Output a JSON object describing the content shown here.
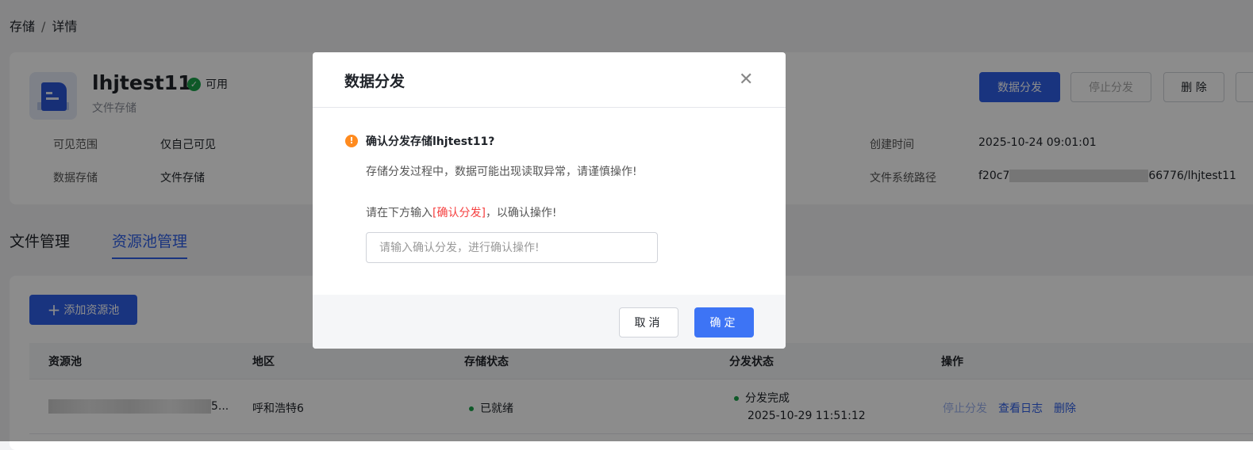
{
  "breadcrumb": {
    "root": "存储",
    "sep": "/",
    "current": "详情"
  },
  "storage": {
    "name": "lhjtest11",
    "status": "可用",
    "type": "文件存储"
  },
  "header_buttons": {
    "distribute": "数据分发",
    "stop": "停止分发",
    "delete": "删 除"
  },
  "info": {
    "visibility_label": "可见范围",
    "visibility": "仅自己可见",
    "storage_label": "数据存储",
    "storage": "文件存储",
    "created_label": "创建时间",
    "created": "2025-10-24 09:01:01",
    "path_label": "文件系统路径",
    "path_prefix": "f20c7",
    "path_suffix": "66776/lhjtest11"
  },
  "tabs": [
    {
      "label": "文件管理"
    },
    {
      "label": "资源池管理"
    }
  ],
  "add_pool": "添加资源池",
  "table": {
    "headers": [
      "资源池",
      "地区",
      "存储状态",
      "分发状态",
      "操作"
    ],
    "rows": [
      {
        "pool_suffix": "5...",
        "region": "呼和浩特6",
        "storage_status": "已就绪",
        "dist_status": "分发完成",
        "dist_time": "2025-10-29 11:51:12",
        "actions": [
          "停止分发",
          "查看日志",
          "删除"
        ]
      }
    ]
  },
  "dialog": {
    "title": "数据分发",
    "question": "确认分发存储lhjtest11?",
    "warning": "存储分发过程中，数据可能出现读取异常，请谨慎操作!",
    "instruction_pre": "请在下方输入",
    "instruction_keyword": "[确认分发]",
    "instruction_post": "，以确认操作!",
    "placeholder": "请输入确认分发，进行确认操作!",
    "cancel": "取消",
    "confirm": "确定"
  }
}
